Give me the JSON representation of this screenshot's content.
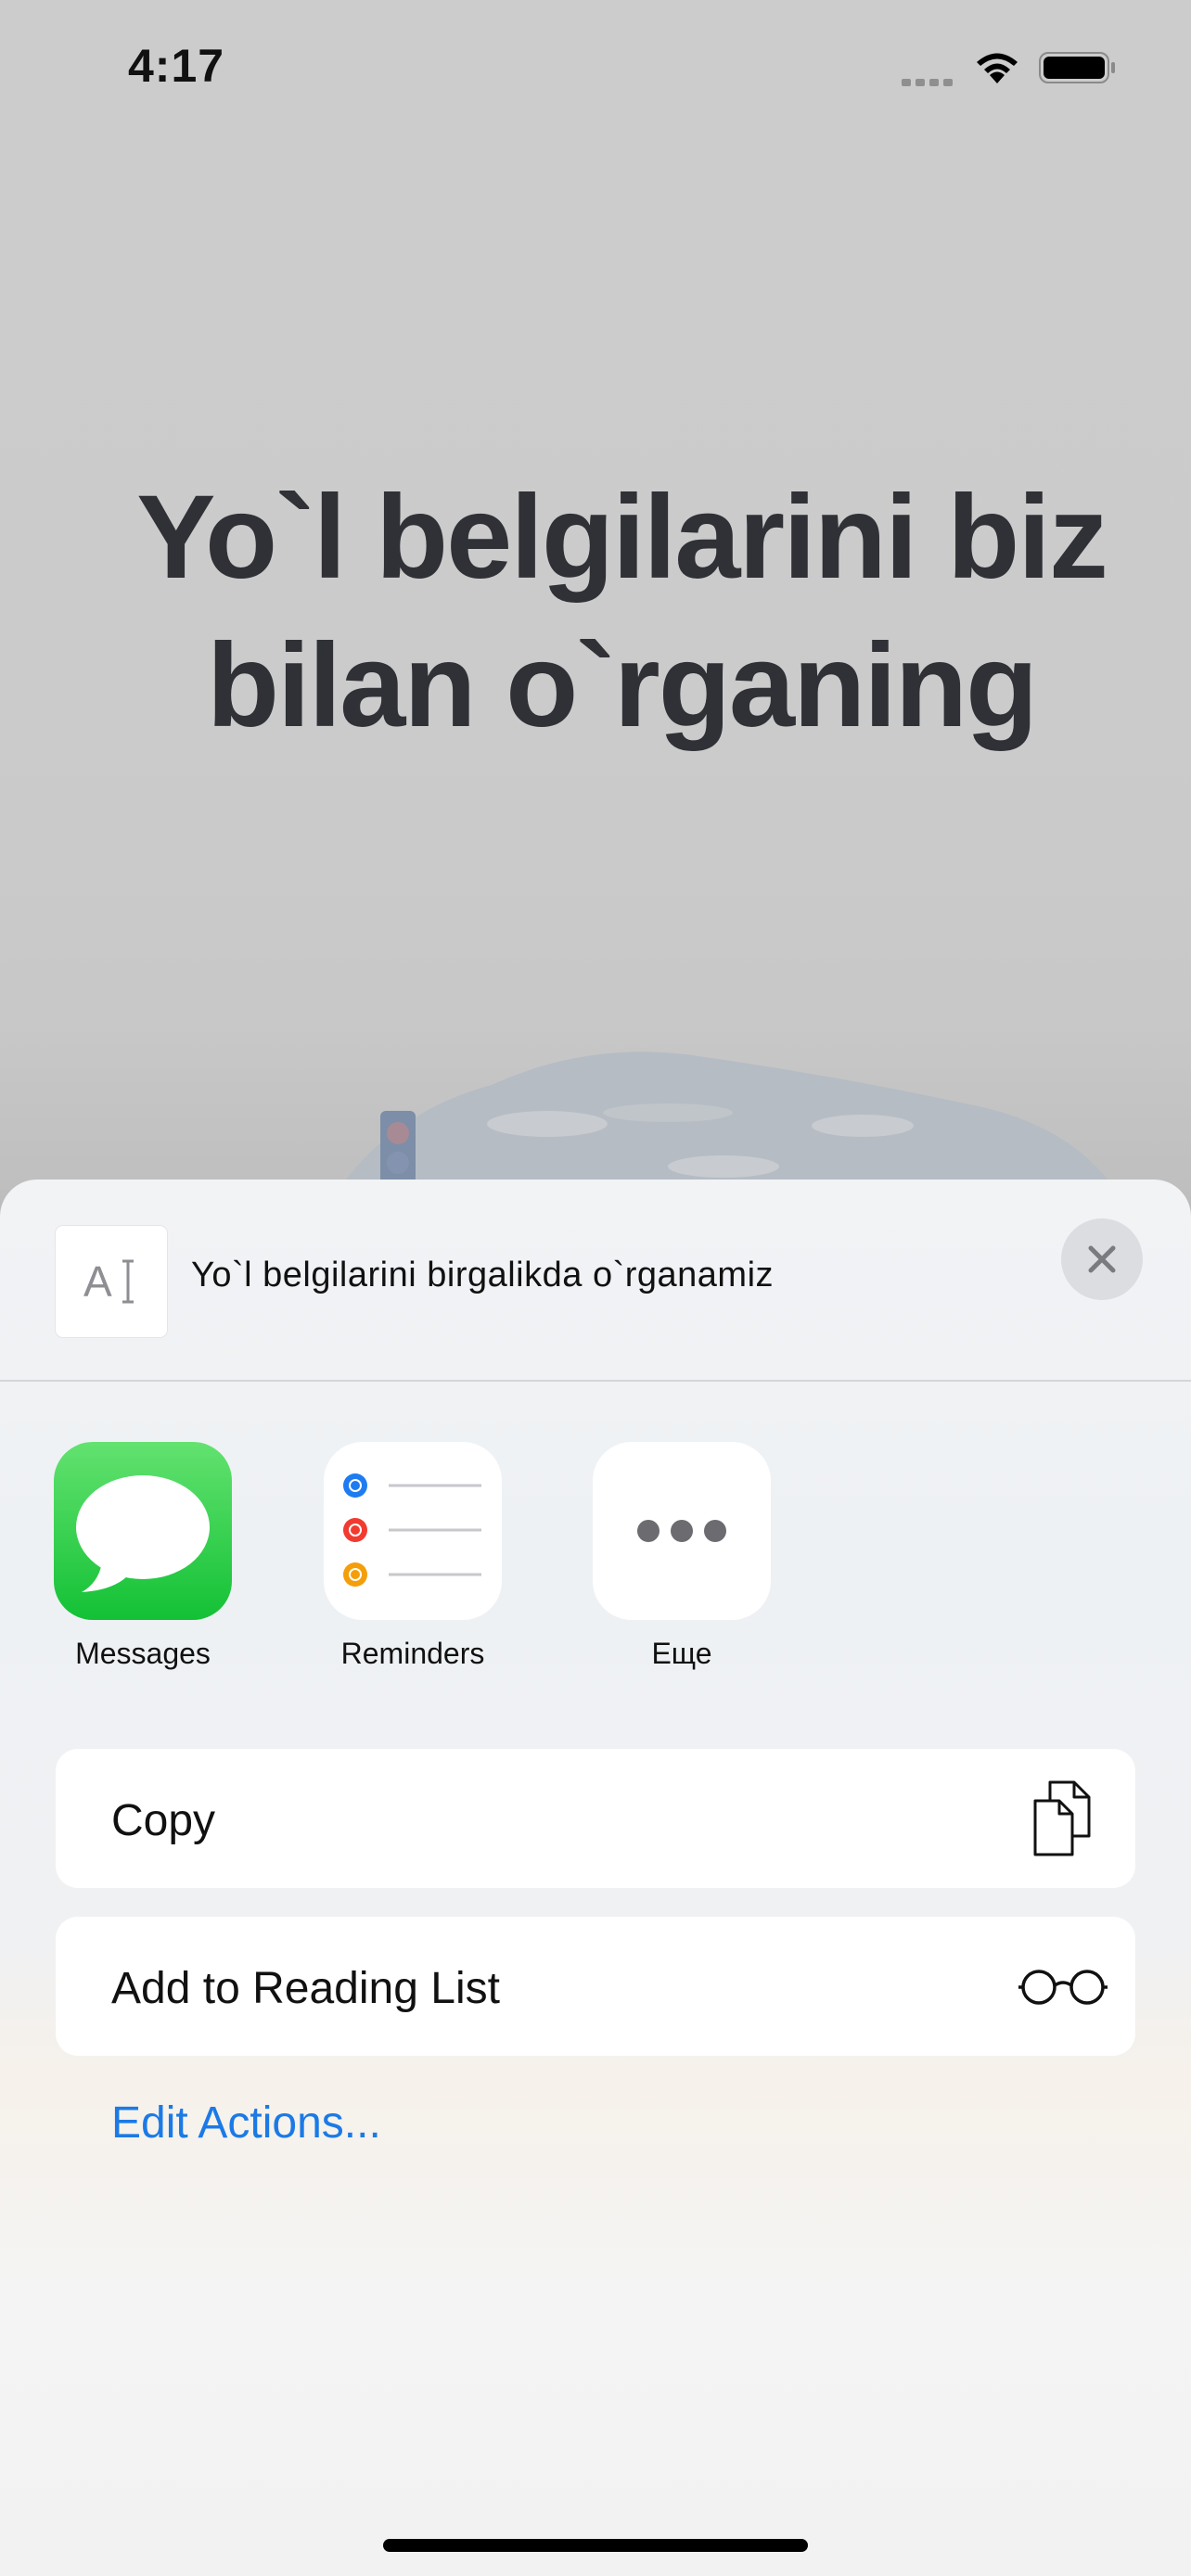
{
  "status_bar": {
    "time": "4:17"
  },
  "hero": {
    "title_line1": "Yo`l belgilarini biz",
    "title_line2": "bilan o`rganing"
  },
  "share_sheet": {
    "preview_text": "Yo`l belgilarini birgalikda o`rganamiz",
    "preview_icon_letter": "A",
    "apps": [
      {
        "label": "Messages",
        "icon": "messages-icon"
      },
      {
        "label": "Reminders",
        "icon": "reminders-icon"
      },
      {
        "label": "Еще",
        "icon": "more-icon"
      }
    ],
    "actions": [
      {
        "label": "Copy",
        "icon": "copy-icon"
      },
      {
        "label": "Add to Reading List",
        "icon": "glasses-icon"
      }
    ],
    "edit_actions_label": "Edit Actions..."
  },
  "colors": {
    "link_blue": "#1b7ae6",
    "messages_green": "#13c135",
    "reminder_blue": "#1e7cf2",
    "reminder_red": "#f23b30",
    "reminder_orange": "#f59e0b"
  }
}
